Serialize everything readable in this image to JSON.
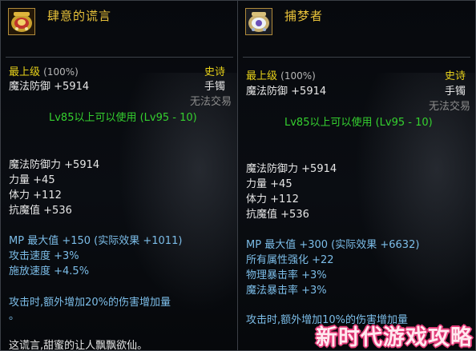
{
  "left": {
    "title": "肆意的谎言",
    "grade_label": "最上级",
    "grade_pct": "(100%)",
    "rarity": "史诗",
    "slot": "手镯",
    "trade": "无法交易",
    "level_req": "Lv85以上可以使用 (Lv95 - 10)",
    "stats": [
      {
        "name": "魔法防御",
        "value": "+5914"
      },
      {
        "name": "魔法防御力",
        "value": "+5914"
      },
      {
        "name": "力量",
        "value": "+45"
      },
      {
        "name": "体力",
        "value": "+112"
      },
      {
        "name": "抗魔值",
        "value": "+536"
      }
    ],
    "bonus": [
      "MP 最大值 +150 (实际效果 +1011)",
      "攻击速度 +3%",
      "施放速度 +4.5%"
    ],
    "effect": "攻击时,额外增加20%的伤害增加量",
    "effect_dot": "。",
    "flavor": "这谎言,甜蜜的让人飘飘欲仙。"
  },
  "right": {
    "title": "捕梦者",
    "grade_label": "最上级",
    "grade_pct": "(100%)",
    "rarity": "史诗",
    "slot": "手镯",
    "trade": "无法交易",
    "level_req": "Lv85以上可以使用 (Lv95 - 10)",
    "stats": [
      {
        "name": "魔法防御",
        "value": "+5914"
      },
      {
        "name": "魔法防御力",
        "value": "+5914"
      },
      {
        "name": "力量",
        "value": "+45"
      },
      {
        "name": "体力",
        "value": "+112"
      },
      {
        "name": "抗魔值",
        "value": "+536"
      }
    ],
    "bonus": [
      "MP 最大值 +300 (实际效果 +6632)",
      "所有属性强化 +22",
      "物理暴击率 +3%",
      "魔法暴击率 +3%"
    ],
    "effect": "攻击时,额外增加10%的伤害增加量"
  },
  "watermark": "新时代游戏攻略",
  "colors": {
    "grade": "#e8d21a",
    "title": "#e8c23a",
    "level_req": "#35d12f",
    "bonus": "#7cbde8",
    "trade": "#8b8b8b"
  }
}
